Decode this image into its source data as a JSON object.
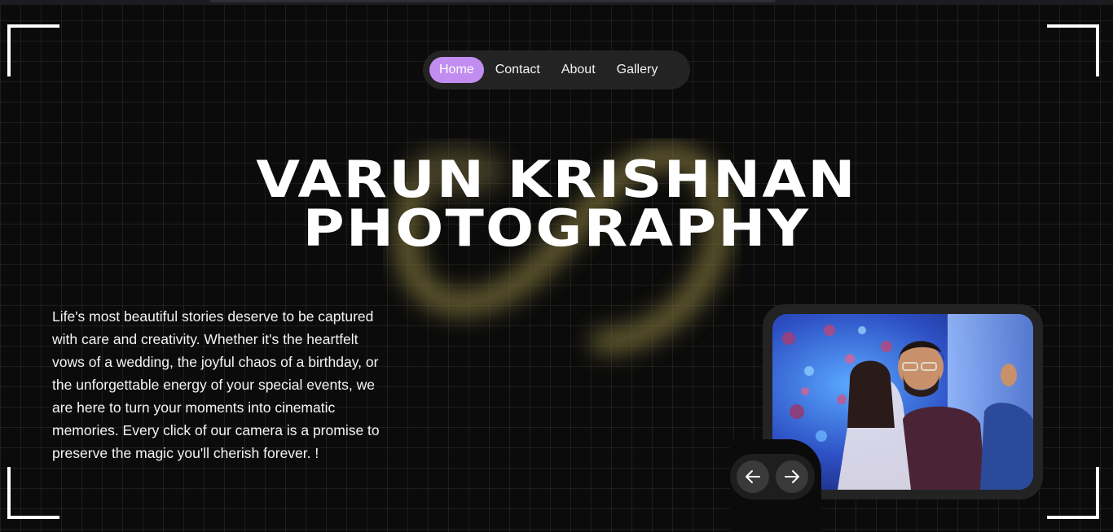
{
  "nav": {
    "items": [
      {
        "label": "Home",
        "active": true
      },
      {
        "label": "Contact",
        "active": false
      },
      {
        "label": "About",
        "active": false
      },
      {
        "label": "Gallery",
        "active": false
      }
    ],
    "accent": "#c28df0"
  },
  "hero": {
    "title_line1": "VARUN KRISHNAN",
    "title_line2": "PHOTOGRAPHY"
  },
  "intro": {
    "text": "Life's most beautiful stories deserve to be captured with care and creativity. Whether it's the heartfelt vows of a wedding, the joyful chaos of a birthday, or the unforgettable energy of your special events, we are here to turn your moments into cinematic memories. Every click of our camera is a promise to preserve the magic you'll cherish forever. !"
  },
  "carousel": {
    "prev_icon": "arrow-left-icon",
    "next_icon": "arrow-right-icon"
  },
  "colors": {
    "background": "#0b0b0b",
    "panel": "#232323",
    "glow": "#6f6634"
  }
}
